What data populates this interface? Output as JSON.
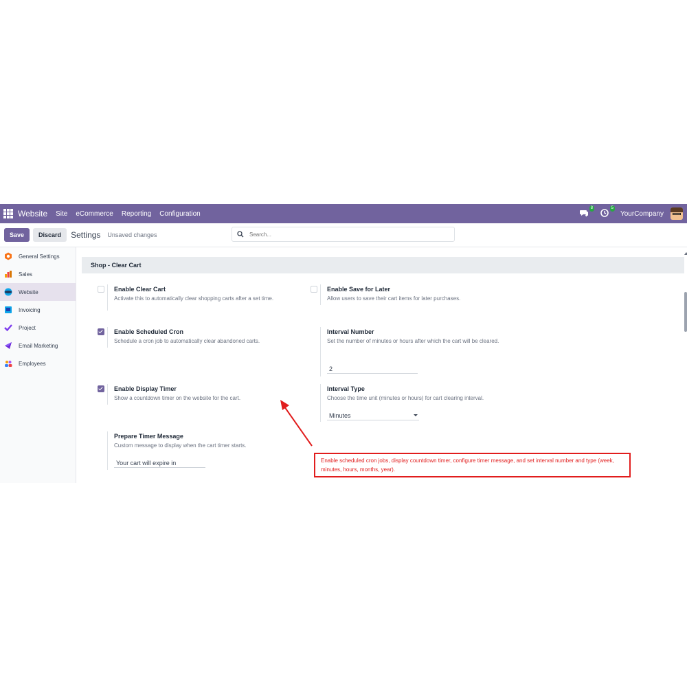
{
  "navbar": {
    "app_name": "Website",
    "menu": [
      "Site",
      "eCommerce",
      "Reporting",
      "Configuration"
    ],
    "messages_count": "8",
    "activities_count": "5",
    "company": "YourCompany",
    "bg_color": "#71639e"
  },
  "control": {
    "save_label": "Save",
    "discard_label": "Discard",
    "breadcrumb": "Settings",
    "status": "Unsaved changes",
    "search_placeholder": "Search..."
  },
  "sidebar": {
    "items": [
      {
        "label": "General Settings",
        "icon": "general-settings-icon"
      },
      {
        "label": "Sales",
        "icon": "sales-icon"
      },
      {
        "label": "Website",
        "icon": "website-icon",
        "active": true
      },
      {
        "label": "Invoicing",
        "icon": "invoicing-icon"
      },
      {
        "label": "Project",
        "icon": "project-icon"
      },
      {
        "label": "Email Marketing",
        "icon": "email-marketing-icon"
      },
      {
        "label": "Employees",
        "icon": "employees-icon"
      }
    ]
  },
  "section": {
    "title": "Shop - Clear Cart"
  },
  "settings": {
    "clear_cart": {
      "title": "Enable Clear Cart",
      "desc": "Activate this to automatically clear shopping carts after a set time.",
      "checked": false
    },
    "save_later": {
      "title": "Enable Save for Later",
      "desc": "Allow users to save their cart items for later purchases.",
      "checked": false
    },
    "cron": {
      "title": "Enable Scheduled Cron",
      "desc": "Schedule a cron job to automatically clear abandoned carts.",
      "checked": true
    },
    "interval_number": {
      "title": "Interval Number",
      "desc": "Set the number of minutes or hours after which the cart will be cleared.",
      "value": "2"
    },
    "timer": {
      "title": "Enable Display Timer",
      "desc": "Show a countdown timer on the website for the cart.",
      "checked": true
    },
    "interval_type": {
      "title": "Interval Type",
      "desc": "Choose the time unit (minutes or hours) for cart clearing interval.",
      "value": "Minutes"
    },
    "timer_message": {
      "title": "Prepare Timer Message",
      "desc": "Custom message to display when the cart timer starts.",
      "value": "Your cart will expire in"
    }
  },
  "callout": {
    "text": "Enable scheduled cron jobs, display countdown timer, configure timer message, and set interval number and type (week, minutes, hours, months, year).",
    "color": "#e11d1d"
  }
}
